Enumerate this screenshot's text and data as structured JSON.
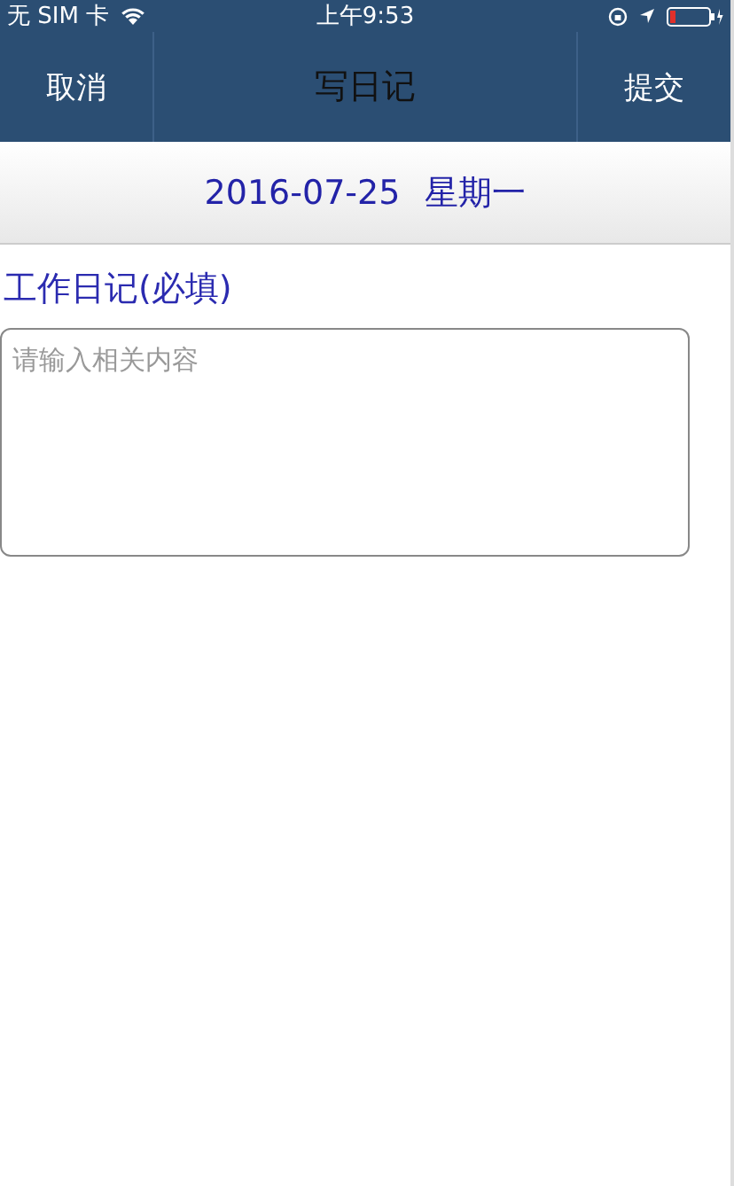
{
  "status_bar": {
    "carrier": "无 SIM 卡",
    "time": "上午9:53"
  },
  "nav_bar": {
    "left_button": "取消",
    "title": "写日记",
    "right_button": "提交"
  },
  "date_bar": {
    "date": "2016-07-25",
    "weekday": "星期一"
  },
  "form": {
    "label": "工作日记(必填)",
    "placeholder": "请输入相关内容"
  }
}
